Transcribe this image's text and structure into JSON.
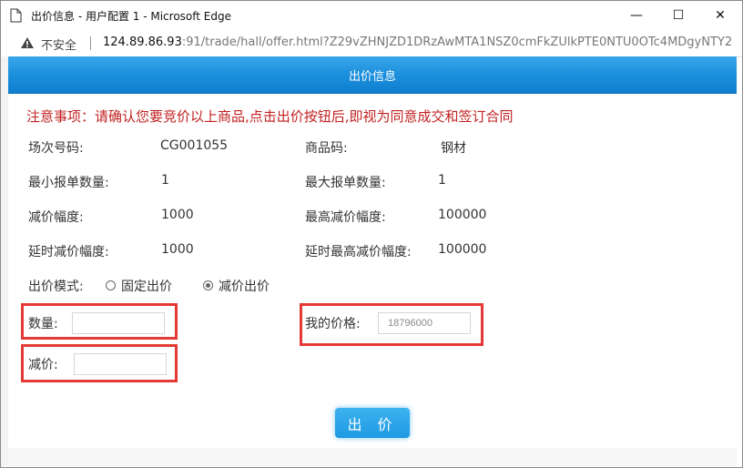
{
  "window": {
    "title": "出价信息 - 用户配置 1 - Microsoft Edge",
    "minimize_label": "—",
    "maximize_label": "☐",
    "close_label": "✕"
  },
  "address": {
    "security_text": "不安全",
    "url_host": "124.89.86.93",
    "url_rest": ":91/trade/hall/offer.html?Z29vZHNJZD1DRzAwMTA1NSZ0cmFkZUlkPTE0NTU0OTc4MDgyNTY2..."
  },
  "dialog": {
    "title": "出价信息",
    "notice": "注意事项：请确认您要竞价以上商品,点击出价按钮后,即视为同意成交和签订合同",
    "fields": {
      "session_no_label": "场次号码:",
      "session_no_value": "CG001055",
      "product_code_label": "商品码:",
      "product_code_value": "钢材",
      "min_qty_label": "最小报单数量:",
      "min_qty_value": "1",
      "max_qty_label": "最大报单数量:",
      "max_qty_value": "1",
      "reduce_step_label": "减价幅度:",
      "reduce_step_value": "1000",
      "max_reduce_label": "最高减价幅度:",
      "max_reduce_value": "100000",
      "delay_reduce_label": "延时减价幅度:",
      "delay_reduce_value": "1000",
      "delay_max_reduce_label": "延时最高减价幅度:",
      "delay_max_reduce_value": "100000"
    },
    "bid_mode": {
      "label": "出价模式:",
      "options": [
        "固定出价",
        "减价出价"
      ],
      "selected": "减价出价"
    },
    "quantity_label": "数量:",
    "quantity_value": "",
    "my_price_label": "我的价格:",
    "my_price_placeholder": "18796000",
    "reduce_label": "减价:",
    "reduce_value": "",
    "submit_label": "出 价"
  },
  "colors": {
    "header_blue": "#1b8fdc",
    "notice_red": "#c22121",
    "highlight_red": "#e53935",
    "button_blue": "#1e9ae3"
  }
}
